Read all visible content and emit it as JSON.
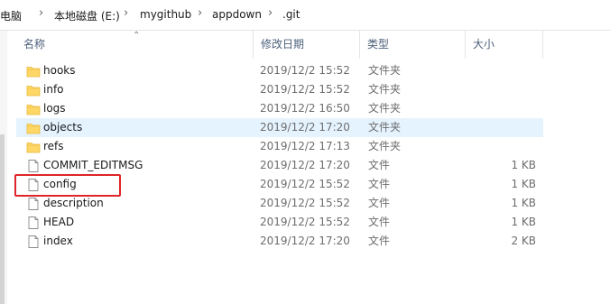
{
  "breadcrumb": {
    "items": [
      "此电脑",
      "本地磁盘 (E:)",
      "mygithub",
      "appdown",
      ".git"
    ],
    "separator": "›"
  },
  "columns": {
    "name": "名称",
    "date": "修改日期",
    "type": "类型",
    "size": "大小"
  },
  "files": [
    {
      "name": "hooks",
      "date": "2019/12/2 15:52",
      "type": "文件夹",
      "size": "",
      "icon": "folder-icon"
    },
    {
      "name": "info",
      "date": "2019/12/2 15:52",
      "type": "文件夹",
      "size": "",
      "icon": "folder-icon"
    },
    {
      "name": "logs",
      "date": "2019/12/2 16:50",
      "type": "文件夹",
      "size": "",
      "icon": "folder-icon"
    },
    {
      "name": "objects",
      "date": "2019/12/2 17:20",
      "type": "文件夹",
      "size": "",
      "icon": "folder-icon",
      "hovered": true
    },
    {
      "name": "refs",
      "date": "2019/12/2 17:13",
      "type": "文件夹",
      "size": "",
      "icon": "folder-icon"
    },
    {
      "name": "COMMIT_EDITMSG",
      "date": "2019/12/2 17:20",
      "type": "文件",
      "size": "1 KB",
      "icon": "file-icon"
    },
    {
      "name": "config",
      "date": "2019/12/2 15:52",
      "type": "文件",
      "size": "1 KB",
      "icon": "file-icon",
      "annotated": true
    },
    {
      "name": "description",
      "date": "2019/12/2 15:52",
      "type": "文件",
      "size": "1 KB",
      "icon": "file-icon"
    },
    {
      "name": "HEAD",
      "date": "2019/12/2 15:52",
      "type": "文件",
      "size": "1 KB",
      "icon": "file-icon"
    },
    {
      "name": "index",
      "date": "2019/12/2 17:20",
      "type": "文件",
      "size": "2 KB",
      "icon": "file-icon"
    }
  ],
  "colors": {
    "hover_row": "#e5f3ff",
    "annotation": "#e0242a",
    "folder": "#ffd766",
    "header_text": "#4c607a"
  }
}
